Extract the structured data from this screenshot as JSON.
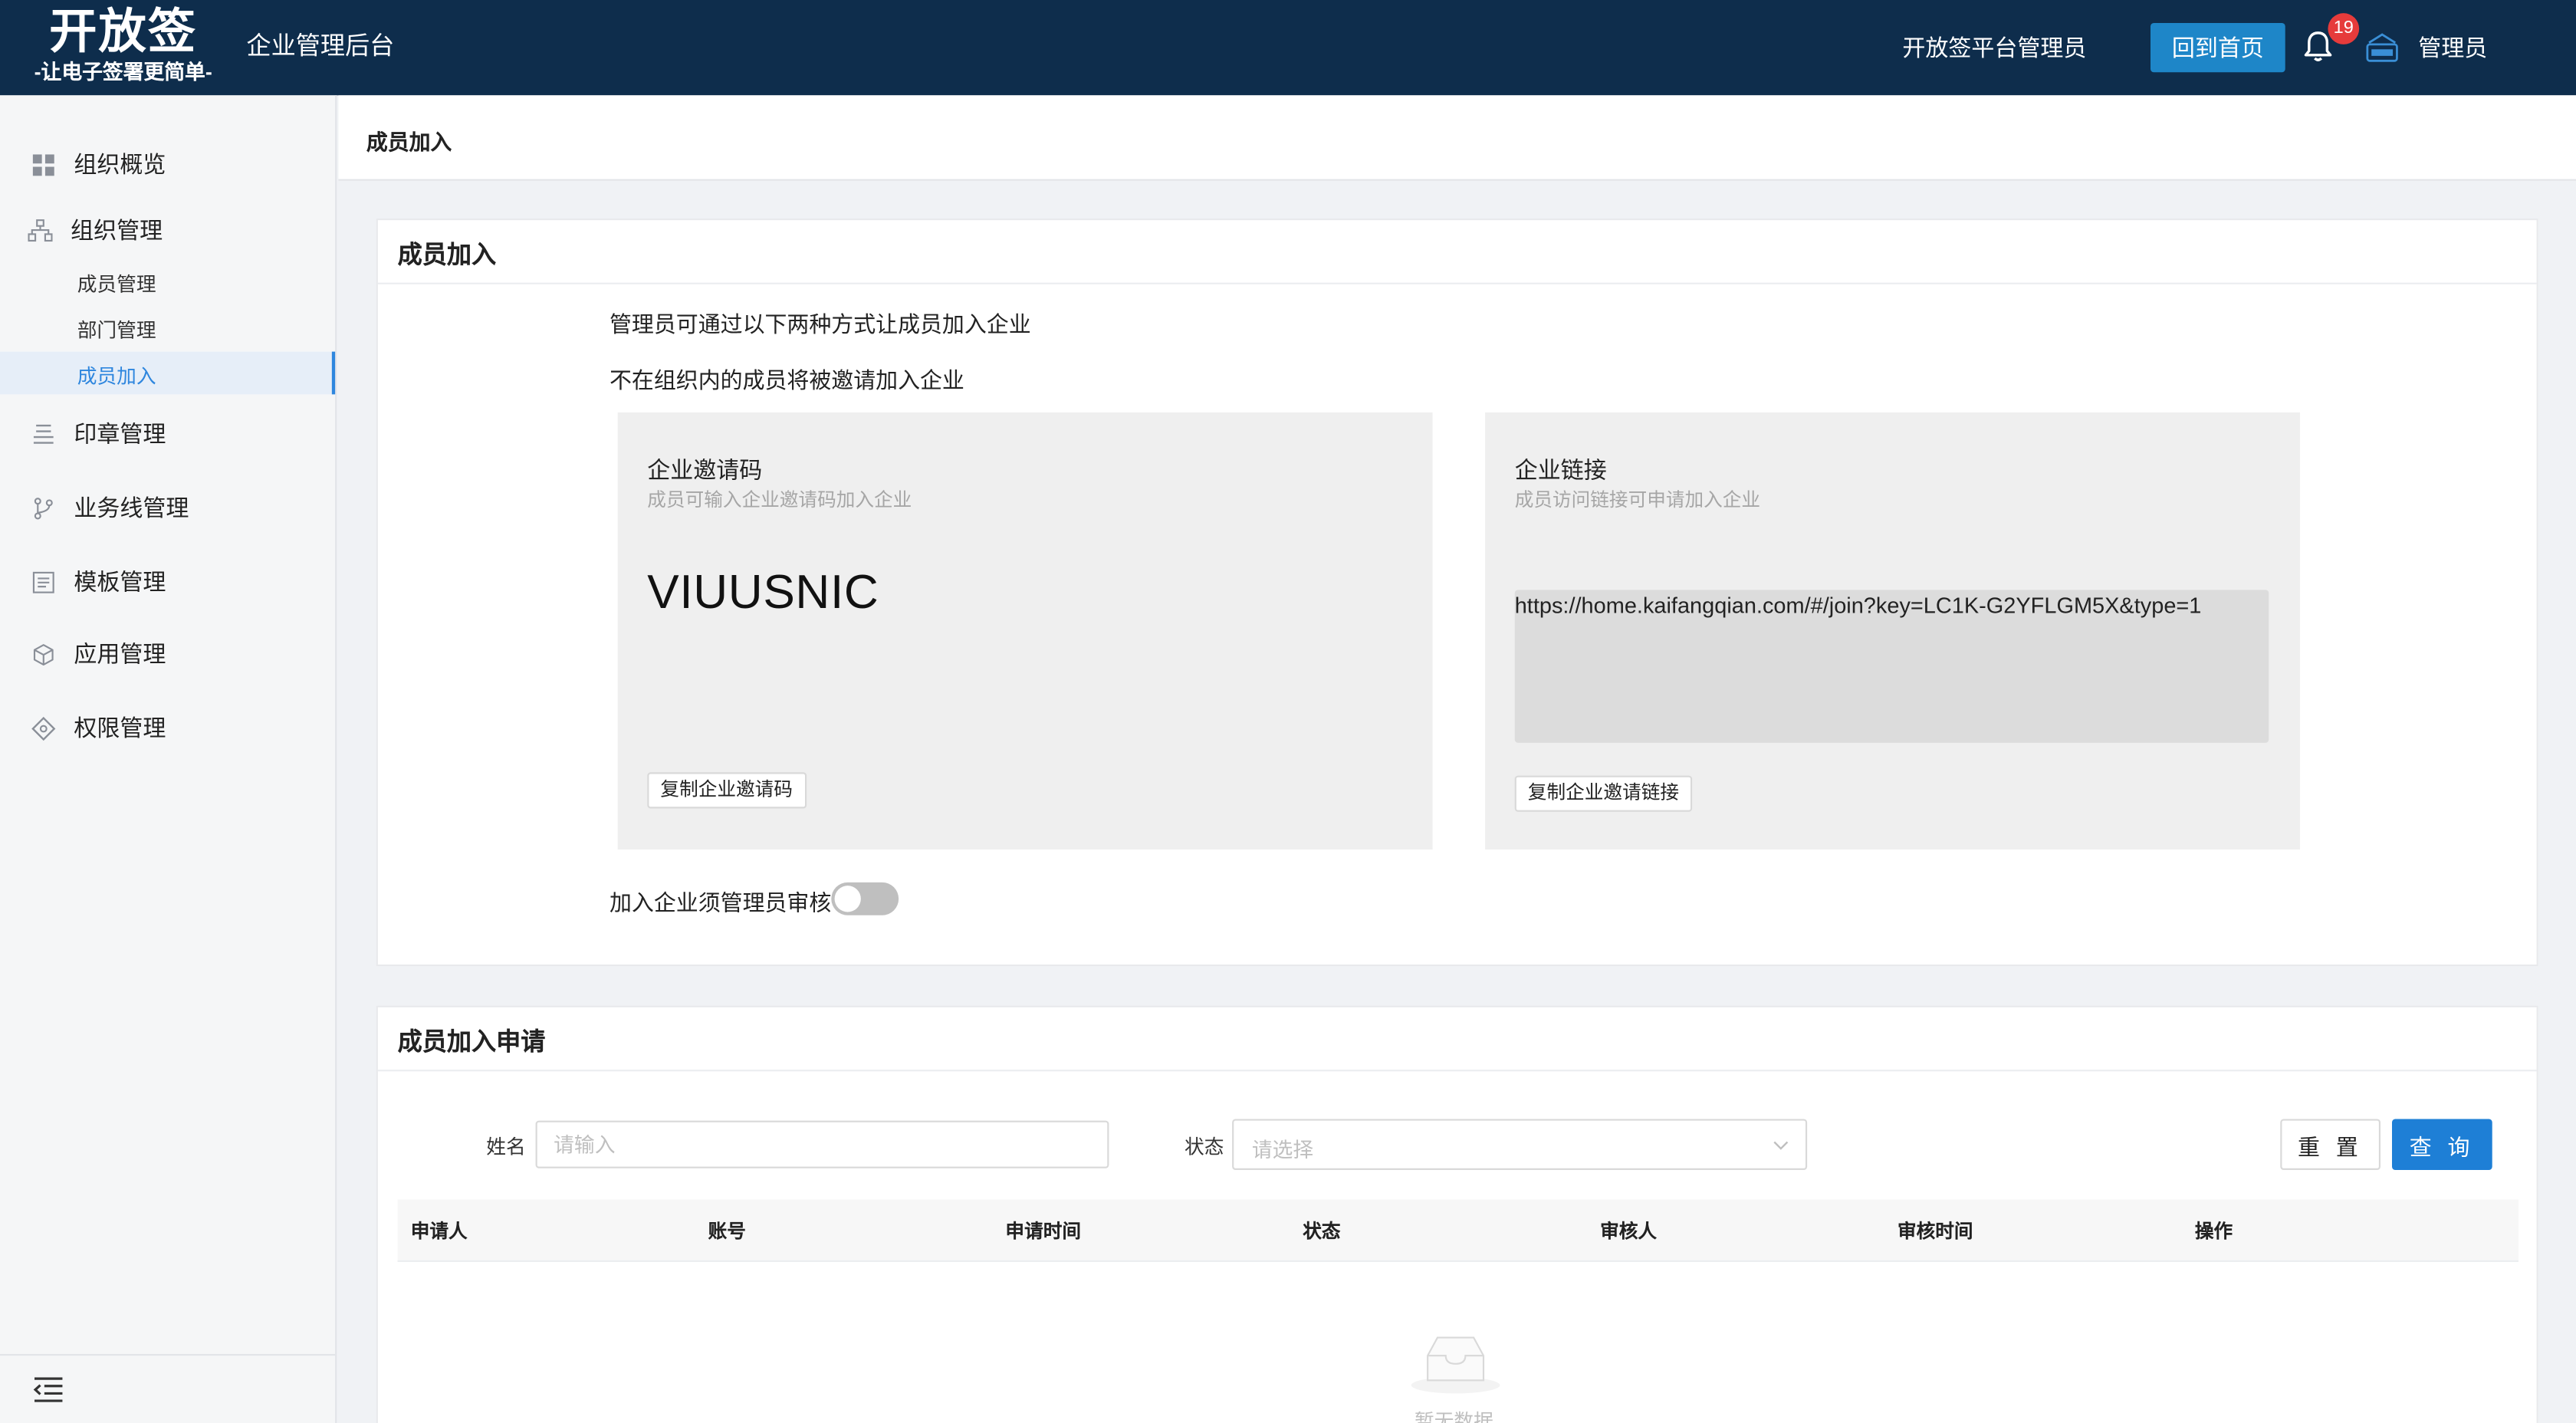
{
  "header": {
    "logo_title": "开放签",
    "logo_sub": "-让电子签署更简单-",
    "app_title": "企业管理后台",
    "platform_admin": "开放签平台管理员",
    "home_button": "回到首页",
    "notification_count": "19",
    "user_name": "管理员"
  },
  "sidebar": {
    "items": [
      {
        "label": "组织概览",
        "icon": "grid-icon"
      },
      {
        "label": "组织管理",
        "icon": "org-tree-icon"
      },
      {
        "label": "印章管理",
        "icon": "stamp-icon"
      },
      {
        "label": "业务线管理",
        "icon": "branch-icon"
      },
      {
        "label": "模板管理",
        "icon": "template-icon"
      },
      {
        "label": "应用管理",
        "icon": "cube-icon"
      },
      {
        "label": "权限管理",
        "icon": "permission-icon"
      }
    ],
    "sub_items": [
      {
        "label": "成员管理",
        "active": false
      },
      {
        "label": "部门管理",
        "active": false
      },
      {
        "label": "成员加入",
        "active": true
      }
    ],
    "collapse_icon": "menu-fold-icon"
  },
  "breadcrumb": "成员加入",
  "join_card": {
    "title": "成员加入",
    "desc_1": "管理员可通过以下两种方式让成员加入企业",
    "desc_2": "不在组织内的成员将被邀请加入企业",
    "invite_panel": {
      "title": "企业邀请码",
      "subtitle": "成员可输入企业邀请码加入企业",
      "code": "VIUUSNIC",
      "copy_button": "复制企业邀请码"
    },
    "link_panel": {
      "title": "企业链接",
      "subtitle": "成员访问链接可申请加入企业",
      "link": "https://home.kaifangqian.com/#/join?key=LC1K-G2YFLGM5X&type=1",
      "copy_button": "复制企业邀请链接"
    },
    "approval_label": "加入企业须管理员审核",
    "approval_enabled": false
  },
  "apply_card": {
    "title": "成员加入申请",
    "filters": {
      "name_label": "姓名",
      "name_placeholder": "请输入",
      "status_label": "状态",
      "status_placeholder": "请选择",
      "reset_button": "重 置",
      "query_button": "查 询"
    },
    "table_columns": [
      "申请人",
      "账号",
      "申请时间",
      "状态",
      "审核人",
      "审核时间",
      "操作"
    ],
    "table_rows": [],
    "empty_text": "暂无数据"
  }
}
